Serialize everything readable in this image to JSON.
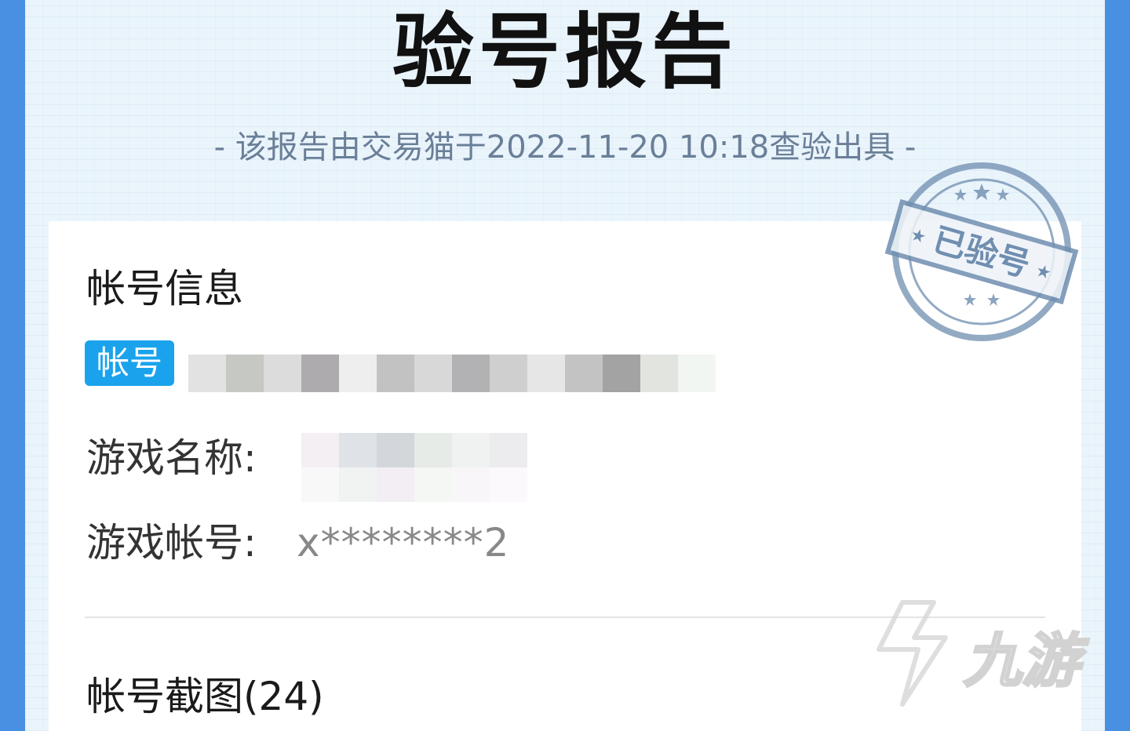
{
  "report": {
    "title": "验号报告",
    "subtitle": "- 该报告由交易猫于2022-11-20 10:18查验出具 -"
  },
  "stamp": {
    "text": "已验号",
    "color": "#6f8eb0"
  },
  "account_info": {
    "section_title": "帐号信息",
    "tag_label": "帐号",
    "game_name_label": "游戏名称:",
    "game_account_label": "游戏帐号:",
    "game_account_value": "x********2"
  },
  "screenshots": {
    "section_title": "帐号截图(24)"
  },
  "watermark": {
    "text": "九游"
  },
  "colors": {
    "frame": "#4a90e2",
    "tag_bg": "#1aa3ec",
    "subtitle": "#6a7f98"
  }
}
